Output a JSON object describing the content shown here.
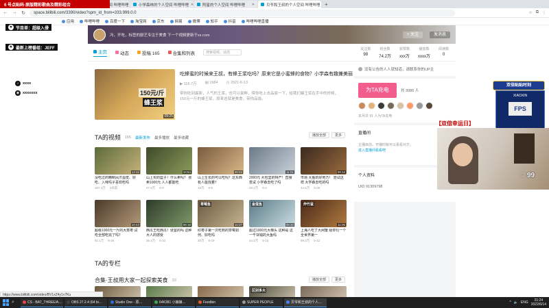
{
  "overlay": {
    "top_banner": "6 号点贴码·原版精彩歌曲及精彩组合",
    "program": "节目单：超级入侵",
    "recent": "最新上榜番组：JEFF",
    "social1": "xxxx",
    "social2": "xxxxxxx",
    "live_badge": "双倍贴贴时刻",
    "widget_title": "XIAOXIN",
    "widget_fps": "FPS",
    "double_text": "【双倍幸运日】",
    "like_count": "99"
  },
  "browser": {
    "tabs": [
      {
        "title": "6 号点贴码·原版精彩歌曲 | 哔哩哔哩",
        "active": false
      },
      {
        "title": "小白兔吃香菜个人空间 哔哩哔哩",
        "active": false
      },
      {
        "title": "小学森林的个人空间 哔哩哔哩",
        "active": false
      },
      {
        "title": "阿星的个人空间 哔哩哔哩",
        "active": false
      },
      {
        "title": "贝爷和王叔的个人空间 哔哩哔哩",
        "active": true
      }
    ],
    "url": "space.bilibili.com/3390/video?spm_id_from=333.999.0.0",
    "bookmarks": [
      "应用",
      "哔哩哔哩",
      "百度一下",
      "淘宝网",
      "京东",
      "网易",
      "微博",
      "知乎",
      "抖音",
      "哔哩哔哩直播"
    ]
  },
  "space": {
    "sign": "冯，开吃，标签的厨艺专注于美食 下一个视频更新于xx.com",
    "follow_label": "+ 关注",
    "message_label": "发消息",
    "tabs": [
      {
        "label": "主页",
        "color": "#00a1d6",
        "active": true
      },
      {
        "label": "动态",
        "color": "#fb7299",
        "active": false
      },
      {
        "label": "投稿 165",
        "color": "#f5a623",
        "active": false
      },
      {
        "label": "合集和列表",
        "color": "#e95b5b",
        "active": false
      }
    ],
    "search_placeholder": "搜索视频、动态",
    "stats": [
      {
        "label": "关注数",
        "value": "98"
      },
      {
        "label": "粉丝数",
        "value": "74.2万"
      },
      {
        "label": "获赞数",
        "value": "xxx万"
      },
      {
        "label": "播放数",
        "value": "xxxx万"
      },
      {
        "label": "阅读数",
        "value": "0"
      }
    ]
  },
  "featured": {
    "title": "吃蜂蜜的时候来王叔，有蜂王浆吃吗？原来它是小蜜蜂的食物？小学森有趣兼美丽",
    "price": "150元/斤",
    "tag": "蜂王浆",
    "duration": "09:25",
    "plays": "116.7万",
    "danmaku": "1984",
    "date": "2021-6-13",
    "desc": "带你吃到最新，人气的王浆，也可以尝鲜，带你吃上去品尝一下，给我们蜂王浆在手中的时候，150元一斤的蜂王浆，原来这就是美食，带你品尝。"
  },
  "videos_section": {
    "title": "TA的视频",
    "count": "165",
    "sorts": [
      "最新发布",
      "最多播放",
      "最多收藏"
    ],
    "btn_play_all": "播放全部",
    "btn_more": "更多",
    "row1": [
      {
        "title": "没吃过的精制凤爪蛋皮、好吃、入味吗子喜欢吃吗",
        "dur": "13:32",
        "plays": "107.4万",
        "date": "3天前",
        "color1": "#5b6b3a",
        "color2": "#c7b27c",
        "label": ""
      },
      {
        "title": "山上买的篮子！什么卖吗？ 张卖1000元 人人都能吃",
        "dur": "10:54",
        "plays": "47.6万",
        "date": "6-9",
        "color1": "#3f4a2a",
        "color2": "#8d9b5b",
        "label": ""
      },
      {
        "title": "山上生长的可以吃吗？这东西 有人能找着？",
        "dur": "09:03",
        "plays": "15万",
        "date": "6-5",
        "color1": "#7a5b3e",
        "color2": "#d9b989",
        "label": ""
      },
      {
        "title": "2000元 大包里的特产！直接 尝试 小学森去吃了吗",
        "dur": "11:01",
        "plays": "28.2万",
        "date": "6-2",
        "color1": "#6b7a88",
        "color2": "#c9d2da",
        "label": ""
      },
      {
        "title": "市场 大鱼的好地方！ 尝试这样 大学森去吃的吗",
        "dur": "09:12",
        "plays": "44.5万",
        "date": "5-29",
        "color1": "#3a2a1e",
        "color2": "#9a6b3d",
        "label": ""
      }
    ],
    "row2": [
      {
        "title": "超级1000元一斤的大蒸枣 试吃全部吃完了吗？",
        "dur": "10:43",
        "plays": "81.1万",
        "date": "5-26",
        "color1": "#4a3a2a",
        "color2": "#b59a7a",
        "label": ""
      },
      {
        "title": "西瓜王吃西瓜！便宜的吗 这种 大人的感受",
        "dur": "08:18",
        "plays": "36.4万",
        "date": "5-22",
        "color1": "#2d3b2a",
        "color2": "#7f9a6a",
        "label": ""
      },
      {
        "title": "红枣子第一次吃到的草莓如何、好吃吗",
        "dur": "10:37",
        "plays": "30万",
        "date": "5-19",
        "color1": "#6a5a42",
        "color2": "#c8b48f",
        "label": "草莓鱼"
      },
      {
        "title": "超过1000元大棵头 这种是 这 一千块钱的大鱼吗",
        "dur": "09:32",
        "plays": "44.3万",
        "date": "5-15",
        "color1": "#5b7b86",
        "color2": "#cbdde3",
        "label": "金蛋鱼"
      },
      {
        "title": "上海人吃了大闸蟹 给你们一个 全世界第一",
        "dur": "11:05",
        "plays": "59.2万",
        "date": "5-12",
        "color1": "#4a2a1a",
        "color2": "#b07a3f",
        "label": "炸竹鼠"
      }
    ]
  },
  "column_section": {
    "title": "TA的专栏"
  },
  "collection_section": {
    "title": "合集·王叔用大家一起探索美食",
    "count": "33",
    "btn_play_all": "播放全部",
    "btn_more": "更多",
    "colors": [
      "#6b5a3e",
      "#5a7b4a",
      "#8a6a4a",
      "#4a4a3a",
      "#7a6a5a"
    ],
    "label": "区别多大"
  },
  "right": {
    "notice": "没有公告的人人就知道，请联系你的UP主",
    "charge_label": "为TA充电",
    "charge_count": "共 3086 人",
    "fan_colors": [
      "#c98a5a",
      "#e3b27a",
      "#3a3a3a",
      "#7a6a5a",
      "#d9c2a5",
      "#ff9a6a",
      "#9a9a9a",
      "#5a4a3a"
    ],
    "charge_note": "本月共 91 人为TA充电",
    "gallery_title": "直播间",
    "gallery_btn": "进入",
    "gallery_empty": "主播目前，开播时就可以看看对方，",
    "gallery_link": "进入直播间看看吧",
    "info_title": "个人资料",
    "uid": "UID  91309798"
  },
  "status_url": "https://www.bilibili.com/video/BV1xZ4y1v7Ku",
  "taskbar": {
    "tasks": [
      {
        "label": "CS - BAT_THREE/A…",
        "color": "#e44"
      },
      {
        "label": "OBS 27.2.4 (64 bi…",
        "color": "#444"
      },
      {
        "label": "Studio One - 原…",
        "color": "#2a6fdb"
      },
      {
        "label": "64K381 小娘娘…",
        "color": "#3aaa55"
      },
      {
        "label": "Feedbin",
        "color": "#e65a2a"
      },
      {
        "label": "SUPER PEOPLE",
        "color": "#999"
      },
      {
        "label": "贝爷和王叔的个人…",
        "color": "#4285f4"
      }
    ],
    "time": "21:24",
    "date": "2022/6/14",
    "lang": "ENG"
  }
}
